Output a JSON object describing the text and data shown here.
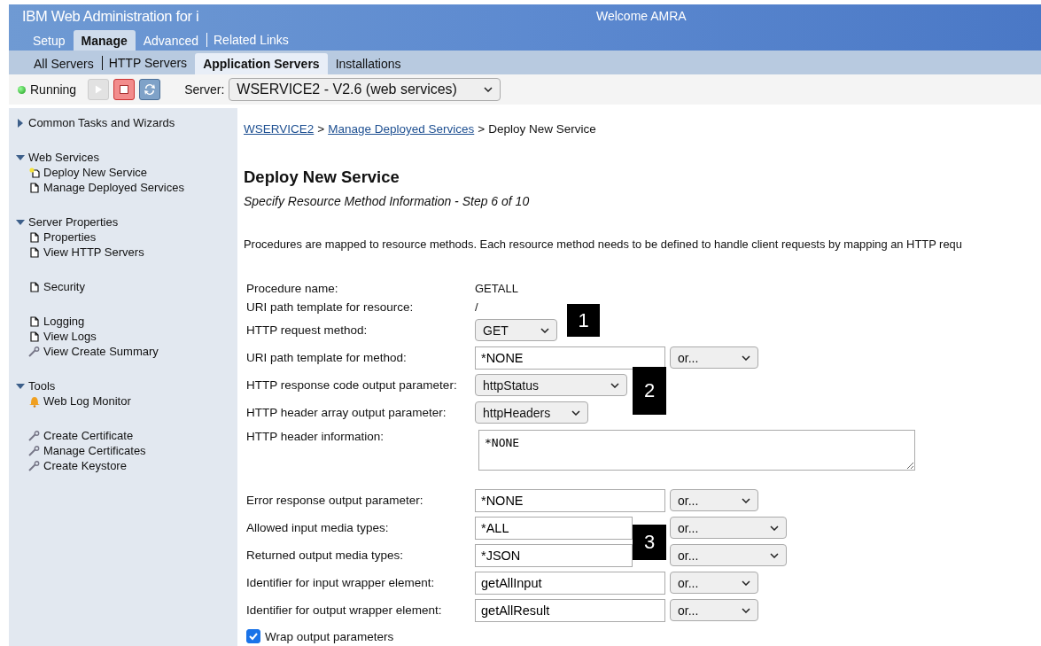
{
  "header": {
    "title": "IBM Web Administration for i",
    "welcome": "Welcome  AMRA"
  },
  "tabs": [
    {
      "label": "Setup",
      "selected": false
    },
    {
      "label": "Manage",
      "selected": true
    },
    {
      "label": "Advanced",
      "selected": false
    },
    {
      "label": "Related Links",
      "selected": false
    }
  ],
  "subtabs": [
    {
      "label": "All Servers",
      "selected": false
    },
    {
      "label": "HTTP Servers",
      "selected": false
    },
    {
      "label": "Application Servers",
      "selected": true
    },
    {
      "label": "Installations",
      "selected": false
    }
  ],
  "toolbar": {
    "status": "Running",
    "running": true,
    "start_disabled": true,
    "server_label": "Server:",
    "server": "WSERVICE2 - V2.6 (web services)"
  },
  "sidebar": [
    {
      "title": "Common Tasks and Wizards",
      "expanded": false
    },
    {
      "title": "Web Services",
      "expanded": true,
      "groups": [
        {
          "items": [
            {
              "label": "Deploy New Service",
              "kind": "new"
            },
            {
              "label": "Manage Deployed Services",
              "kind": "page"
            }
          ]
        }
      ]
    },
    {
      "title": "Server Properties",
      "expanded": true,
      "groups": [
        {
          "items": [
            {
              "label": "Properties",
              "kind": "page"
            },
            {
              "label": "View HTTP Servers",
              "kind": "page"
            }
          ]
        },
        {
          "items": [
            {
              "label": "Security",
              "kind": "page"
            }
          ]
        },
        {
          "items": [
            {
              "label": "Logging",
              "kind": "page"
            },
            {
              "label": "View Logs",
              "kind": "page"
            },
            {
              "label": "View Create Summary",
              "kind": "wrench"
            }
          ]
        }
      ]
    },
    {
      "title": "Tools",
      "expanded": true,
      "groups": [
        {
          "items": [
            {
              "label": "Web Log Monitor",
              "kind": "bell"
            }
          ]
        },
        {
          "items": [
            {
              "label": "Create Certificate",
              "kind": "wrench"
            },
            {
              "label": "Manage Certificates",
              "kind": "wrench"
            },
            {
              "label": "Create Keystore",
              "kind": "wrench"
            }
          ]
        }
      ]
    }
  ],
  "breadcrumb": [
    {
      "label": "WSERVICE2",
      "kind": "link"
    },
    {
      "label": ">",
      "kind": "text"
    },
    {
      "label": "Manage Deployed Services",
      "kind": "link"
    },
    {
      "label": ">",
      "kind": "text"
    },
    {
      "label": "Deploy New Service",
      "kind": "text"
    }
  ],
  "page": {
    "title": "Deploy New Service",
    "subtitle": "Specify Resource Method Information - Step 6 of 10",
    "intro": "Procedures are mapped to resource methods. Each resource method needs to be defined to handle client requests by mapping an HTTP requ"
  },
  "form": [
    {
      "kind": "text",
      "label": "Procedure name:",
      "value": "GETALL"
    },
    {
      "kind": "text",
      "label": "URI path template for resource:",
      "value": "/"
    },
    {
      "kind": "select",
      "label": "HTTP request method:",
      "value": "GET"
    },
    {
      "kind": "input",
      "label": "URI path template for method:",
      "value": "*NONE",
      "option": "or..."
    },
    {
      "kind": "select",
      "label": "HTTP response code output parameter:",
      "value": "httpStatus"
    },
    {
      "kind": "select",
      "label": "HTTP header array output parameter:",
      "value": "httpHeaders"
    },
    {
      "kind": "textarea",
      "label": "HTTP header information:",
      "value": "*NONE"
    },
    {
      "kind": "input",
      "label": "Error response output parameter:",
      "value": "*NONE",
      "option": "or..."
    },
    {
      "kind": "input",
      "label": "Allowed input media types:",
      "value": "*ALL",
      "option": "or..."
    },
    {
      "kind": "input",
      "label": "Returned output media types:",
      "value": "*JSON",
      "option": "or..."
    },
    {
      "kind": "input",
      "label": "Identifier for input wrapper element:",
      "value": "getAllInput",
      "option": "or..."
    },
    {
      "kind": "input",
      "label": "Identifier for output wrapper element:",
      "value": "getAllResult",
      "option": "or..."
    },
    {
      "kind": "checkbox",
      "label": "Wrap output parameters",
      "checked": true
    }
  ],
  "callouts": [
    {
      "label": "1"
    },
    {
      "label": "2"
    },
    {
      "label": "3"
    }
  ]
}
